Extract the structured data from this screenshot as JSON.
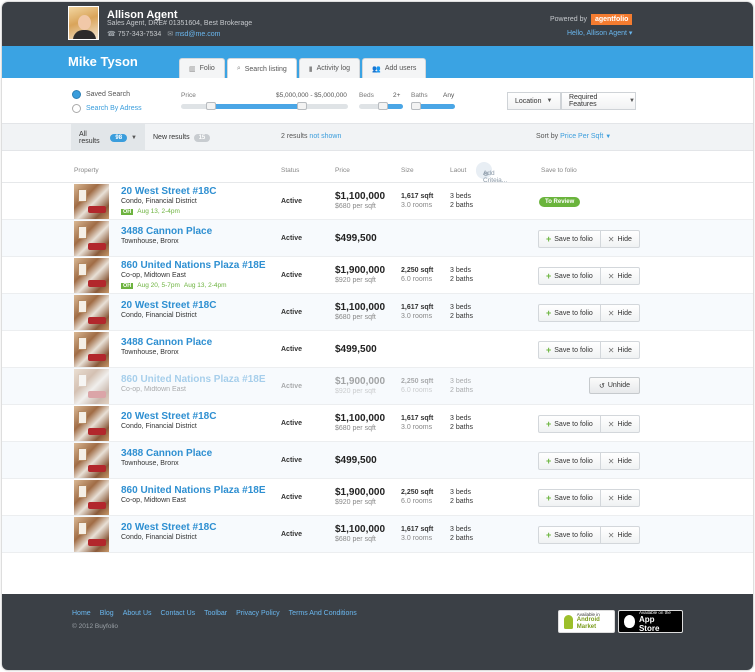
{
  "agent": {
    "name": "Allison Agent",
    "subtitle": "Sales Agent, DRE# 01351604, Best Brokerage",
    "phone": "757-343-7534",
    "email": "msd@me.com"
  },
  "powered_by": "Powered by",
  "brand_logo": "agentfolio",
  "hello": "Hello, Allison Agent",
  "client_name": "Mike Tyson",
  "tabs": [
    {
      "label": "Folio",
      "icon": "folio-icon"
    },
    {
      "label": "Search listing",
      "icon": "search-icon"
    },
    {
      "label": "Activity log",
      "icon": "chart-icon"
    },
    {
      "label": "Add users",
      "icon": "users-icon"
    }
  ],
  "filters": {
    "saved_search": "Saved Search",
    "search_by_address": "Search By Adress",
    "price_label": "Price",
    "price_range": "$5,000,000 - $5,000,000",
    "beds_label": "Beds",
    "beds_value": "2+",
    "baths_label": "Baths",
    "baths_value": "Any",
    "location": "Location",
    "required_features": "Required Features"
  },
  "results": {
    "all_label": "All results",
    "all_count": "98",
    "new_label": "New results",
    "new_count": "15",
    "info": "2 results",
    "info_link": "not shown",
    "sort_label": "Sort by",
    "sort_value": "Price Per Sqft"
  },
  "columns": {
    "property": "Property",
    "status": "Status",
    "price": "Price",
    "size": "Size",
    "layout": "Laout",
    "add_criteria": "Add Criteia...",
    "save": "Save to folio"
  },
  "actions": {
    "to_review": "To Review",
    "save": "Save to folio",
    "hide": "Hide",
    "unhide": "Unhide"
  },
  "rows": [
    {
      "title": "20 West Street #18C",
      "sub": "Condo, Financial District",
      "oh_tag": "OH",
      "oh": [
        "Aug 13, 2-4pm"
      ],
      "status": "Active",
      "price": "$1,100,000",
      "pps": "$680 per sqft",
      "size": "1,617 sqft",
      "rooms": "3.0 rooms",
      "beds": "3 beds",
      "baths": "2 baths",
      "action": "review",
      "faded": false
    },
    {
      "title": "3488 Cannon Place",
      "sub": "Townhouse, Bronx",
      "oh": [],
      "status": "Active",
      "price": "$499,500",
      "pps": "",
      "size": "",
      "rooms": "",
      "beds": "",
      "baths": "",
      "action": "save",
      "faded": false
    },
    {
      "title": "860 United Nations Plaza #18E",
      "sub": "Co-op, Midtown East",
      "oh_tag": "OH",
      "oh": [
        "Aug 20, 5-7pm",
        "Aug 13, 2-4pm"
      ],
      "status": "Active",
      "price": "$1,900,000",
      "pps": "$920 per sqft",
      "size": "2,250 sqft",
      "rooms": "6.0 rooms",
      "beds": "3 beds",
      "baths": "2 baths",
      "action": "save",
      "faded": false
    },
    {
      "title": "20 West Street #18C",
      "sub": "Condo, Financial District",
      "oh": [],
      "status": "Active",
      "price": "$1,100,000",
      "pps": "$680 per sqft",
      "size": "1,617 sqft",
      "rooms": "3.0 rooms",
      "beds": "3 beds",
      "baths": "2 baths",
      "action": "save",
      "faded": false
    },
    {
      "title": "3488 Cannon Place",
      "sub": "Townhouse, Bronx",
      "oh": [],
      "status": "Active",
      "price": "$499,500",
      "pps": "",
      "size": "",
      "rooms": "",
      "beds": "",
      "baths": "",
      "action": "save",
      "faded": false
    },
    {
      "title": "860 United Nations Plaza #18E",
      "sub": "Co-op, Midtown East",
      "oh": [],
      "status": "Active",
      "price": "$1,900,000",
      "pps": "$920 per sqft",
      "size": "2,250 sqft",
      "rooms": "6.0 rooms",
      "beds": "3 beds",
      "baths": "2 baths",
      "action": "unhide",
      "faded": true
    },
    {
      "title": "20 West Street #18C",
      "sub": "Condo, Financial District",
      "oh": [],
      "status": "Active",
      "price": "$1,100,000",
      "pps": "$680 per sqft",
      "size": "1,617 sqft",
      "rooms": "3.0 rooms",
      "beds": "3 beds",
      "baths": "2 baths",
      "action": "save",
      "faded": false
    },
    {
      "title": "3488 Cannon Place",
      "sub": "Townhouse, Bronx",
      "oh": [],
      "status": "Active",
      "price": "$499,500",
      "pps": "",
      "size": "",
      "rooms": "",
      "beds": "",
      "baths": "",
      "action": "save",
      "faded": false
    },
    {
      "title": "860 United Nations Plaza #18E",
      "sub": "Co-op, Midtown East",
      "oh": [],
      "status": "Active",
      "price": "$1,900,000",
      "pps": "$920 per sqft",
      "size": "2,250 sqft",
      "rooms": "6.0 rooms",
      "beds": "3 beds",
      "baths": "2 baths",
      "action": "save",
      "faded": false
    },
    {
      "title": "20 West Street #18C",
      "sub": "Condo, Financial District",
      "oh": [],
      "status": "Active",
      "price": "$1,100,000",
      "pps": "$680 per sqft",
      "size": "1,617 sqft",
      "rooms": "3.0 rooms",
      "beds": "3 beds",
      "baths": "2 baths",
      "action": "save",
      "faded": false
    }
  ],
  "footer": {
    "links": [
      "Home",
      "Blog",
      "About Us",
      "Contact Us",
      "Toolbar",
      "Privacy Policy",
      "Terms And Conditions"
    ],
    "copyright": "© 2012 Buyfolio",
    "android_small": "Available in",
    "android_big": "Android Market",
    "apple_small": "Available on the",
    "apple_big": "App Store"
  },
  "colors": {
    "header": "#3b4046",
    "accent_blue": "#3aa3e3",
    "link": "#2e8fd1",
    "open_house_green": "#6db33f",
    "brand_orange": "#f47c30"
  }
}
